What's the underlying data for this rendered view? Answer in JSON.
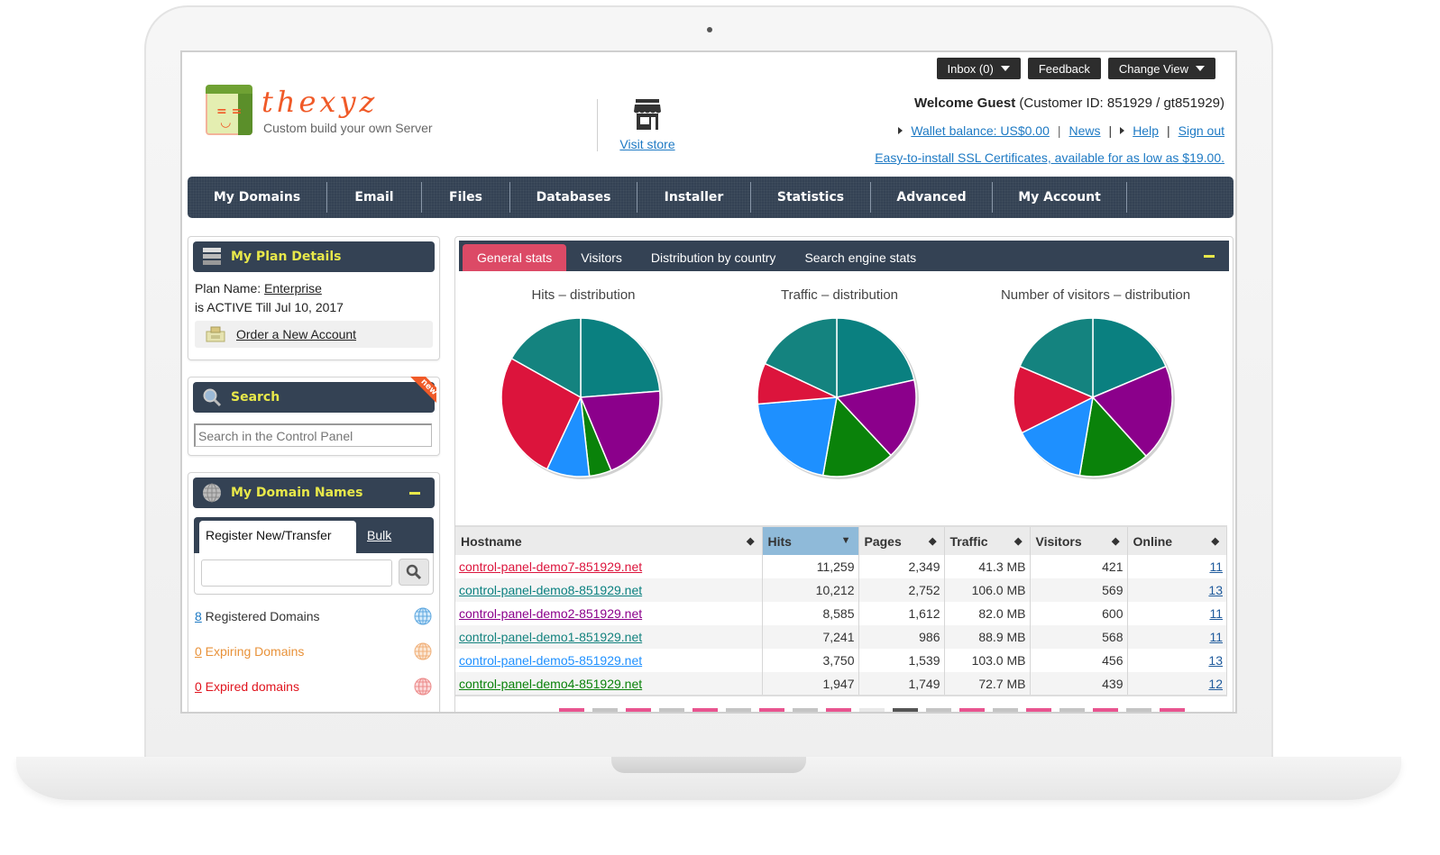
{
  "header": {
    "logo_name": "thexyz",
    "logo_tagline": "Custom build your own Server",
    "visit_store": "Visit store",
    "top_buttons": {
      "inbox": "Inbox (0)",
      "feedback": "Feedback",
      "change_view": "Change View"
    },
    "welcome_bold": "Welcome Guest",
    "welcome_rest": " (Customer ID: 851929 / gt851929)",
    "links": {
      "wallet": "Wallet balance: US$0.00",
      "news": "News",
      "help": "Help",
      "sign_out": "Sign out",
      "sep": "|"
    },
    "ssl_promo": "Easy-to-install SSL Certificates, available for as low as $19.00."
  },
  "nav": [
    {
      "label": "My Domains"
    },
    {
      "label": "Email"
    },
    {
      "label": "Files"
    },
    {
      "label": "Databases"
    },
    {
      "label": "Installer"
    },
    {
      "label": "Statistics"
    },
    {
      "label": "Advanced"
    },
    {
      "label": "My Account"
    }
  ],
  "plan": {
    "title": "My Plan Details",
    "plan_label": "Plan Name: ",
    "plan_name": "Enterprise",
    "status": "is ACTIVE Till Jul 10, 2017",
    "order": "Order a New Account"
  },
  "search": {
    "title": "Search",
    "badge": "new",
    "placeholder": "Search in the Control Panel"
  },
  "domains": {
    "title": "My Domain Names",
    "tab_register": "Register New/Transfer",
    "tab_bulk": "Bulk",
    "input_value": "",
    "registered_count": "8",
    "registered_label": " Registered Domains",
    "expiring_count": "0",
    "expiring_label": " Expiring Domains",
    "expired_count": "0",
    "expired_label": " Expired domains",
    "colors": {
      "registered": "#333333",
      "expiring": "#e8923a",
      "expired": "#e0141e"
    }
  },
  "stats": {
    "tabs": [
      "General stats",
      "Visitors",
      "Distribution by country",
      "Search engine stats"
    ],
    "active_tab": "General stats",
    "accent": "#dc4a66"
  },
  "chart_data": [
    {
      "type": "pie",
      "title": "Hits – distribution",
      "labels": [
        "control-panel-demo7-851929.net",
        "control-panel-demo8-851929.net",
        "control-panel-demo2-851929.net",
        "control-panel-demo1-851929.net",
        "control-panel-demo5-851929.net",
        "control-panel-demo4-851929.net"
      ],
      "values": [
        11259,
        10212,
        8585,
        7241,
        3750,
        1947
      ],
      "slice_order_clockwise_from_top": [
        "demo8",
        "demo2",
        "demo4",
        "demo5",
        "demo7",
        "demo1"
      ]
    },
    {
      "type": "pie",
      "title": "Traffic – distribution",
      "labels": [
        "control-panel-demo7-851929.net",
        "control-panel-demo8-851929.net",
        "control-panel-demo2-851929.net",
        "control-panel-demo1-851929.net",
        "control-panel-demo5-851929.net",
        "control-panel-demo4-851929.net"
      ],
      "values": [
        41.3,
        106.0,
        82.0,
        88.9,
        103.0,
        72.7
      ],
      "unit": "MB"
    },
    {
      "type": "pie",
      "title": "Number of visitors – distribution",
      "labels": [
        "control-panel-demo7-851929.net",
        "control-panel-demo8-851929.net",
        "control-panel-demo2-851929.net",
        "control-panel-demo1-851929.net",
        "control-panel-demo5-851929.net",
        "control-panel-demo4-851929.net"
      ],
      "values": [
        421,
        569,
        600,
        568,
        456,
        439
      ]
    }
  ],
  "pie_slices": [
    {
      "key": "demo8",
      "color": "#0a8080"
    },
    {
      "key": "demo2",
      "color": "#8b008b"
    },
    {
      "key": "demo4",
      "color": "#0a820a"
    },
    {
      "key": "demo5",
      "color": "#1e90ff"
    },
    {
      "key": "demo7",
      "color": "#dc143c"
    },
    {
      "key": "demo1",
      "color": "#14837f"
    }
  ],
  "table": {
    "columns": [
      "Hostname",
      "Hits",
      "Pages",
      "Traffic",
      "Visitors",
      "Online"
    ],
    "sorted_column": "Hits",
    "rows": [
      {
        "host": "control-panel-demo7-851929.net",
        "color": "#dc143c",
        "hits": "11,259",
        "pages": "2,349",
        "traffic": "41.3 MB",
        "visitors": "421",
        "online": "11"
      },
      {
        "host": "control-panel-demo8-851929.net",
        "color": "#0a8080",
        "hits": "10,212",
        "pages": "2,752",
        "traffic": "106.0 MB",
        "visitors": "569",
        "online": "13"
      },
      {
        "host": "control-panel-demo2-851929.net",
        "color": "#8b008b",
        "hits": "8,585",
        "pages": "1,612",
        "traffic": "82.0 MB",
        "visitors": "600",
        "online": "11"
      },
      {
        "host": "control-panel-demo1-851929.net",
        "color": "#14837f",
        "hits": "7,241",
        "pages": "986",
        "traffic": "88.9 MB",
        "visitors": "568",
        "online": "11"
      },
      {
        "host": "control-panel-demo5-851929.net",
        "color": "#1e90ff",
        "hits": "3,750",
        "pages": "1,539",
        "traffic": "103.0 MB",
        "visitors": "456",
        "online": "13"
      },
      {
        "host": "control-panel-demo4-851929.net",
        "color": "#0a820a",
        "hits": "1,947",
        "pages": "1,749",
        "traffic": "72.7 MB",
        "visitors": "439",
        "online": "12"
      }
    ]
  },
  "pager": [
    "pink",
    "gray",
    "pink",
    "gray",
    "pink",
    "gray",
    "pink",
    "gray",
    "pink",
    "light",
    "dark",
    "gray",
    "pink",
    "gray",
    "pink",
    "gray",
    "pink",
    "gray",
    "pink"
  ]
}
